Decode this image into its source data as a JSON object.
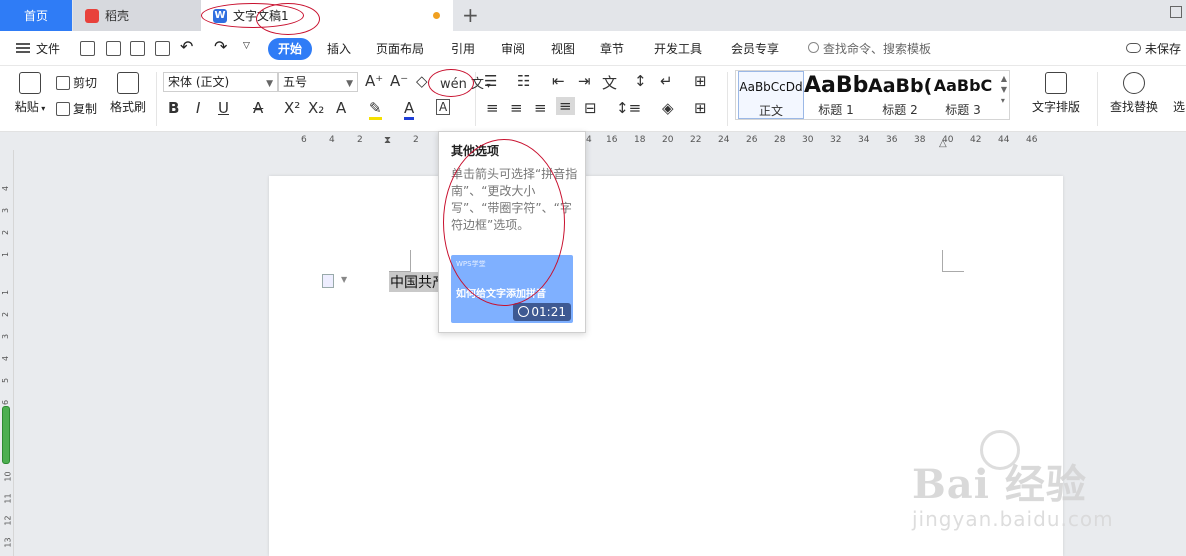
{
  "tabs": {
    "home": "首页",
    "doc1": "稻壳",
    "doc2": "文字文稿1",
    "add": "+"
  },
  "menu": {
    "file": "文件",
    "start": "开始",
    "insert": "插入",
    "layout": "页面布局",
    "reference": "引用",
    "review": "审阅",
    "view": "视图",
    "section": "章节",
    "dev": "开发工具",
    "member": "会员专享",
    "search_placeholder": "查找命令、搜索模板",
    "unsaved": "未保存"
  },
  "ribbon": {
    "paste": "粘贴",
    "cut": "剪切",
    "copy": "复制",
    "format_painter": "格式刷",
    "font_name": "宋体 (正文)",
    "font_size": "五号",
    "phonetic_glyph": "wén 文",
    "styles": [
      {
        "preview": "AaBbCcDd",
        "label": "正文"
      },
      {
        "preview": "AaBb",
        "label": "标题 1"
      },
      {
        "preview": "AaBb(",
        "label": "标题 2"
      },
      {
        "preview": "AaBbC",
        "label": "标题 3"
      }
    ],
    "text_layout": "文字排版",
    "find_replace": "查找替换",
    "select": "选"
  },
  "ruler": {
    "h_ticks": [
      "6",
      "4",
      "2",
      "2",
      "4",
      "16",
      "18",
      "20",
      "22",
      "24",
      "26",
      "28",
      "30",
      "32",
      "34",
      "36",
      "38",
      "40",
      "42",
      "44",
      "46"
    ],
    "v_ticks": [
      "4",
      "3",
      "2",
      "1",
      "1",
      "2",
      "3",
      "4",
      "5",
      "6",
      "10",
      "11",
      "12",
      "13"
    ]
  },
  "document": {
    "text": "中国共产"
  },
  "tooltip": {
    "title": "其他选项",
    "desc": "单击箭头可选择“拼音指南”、“更改大小写”、“带圈字符”、“字符边框”选项。",
    "video_brand": "WPS学堂",
    "video_title": "如何给文字添加拼音",
    "video_time": "01:21"
  },
  "watermark": {
    "main": "Bai  经验",
    "sub": "jingyan.baidu.com"
  },
  "colors": {
    "accent": "#2f7cf6",
    "annotation": "#c8102e",
    "modified_dot": "#f0a020"
  }
}
